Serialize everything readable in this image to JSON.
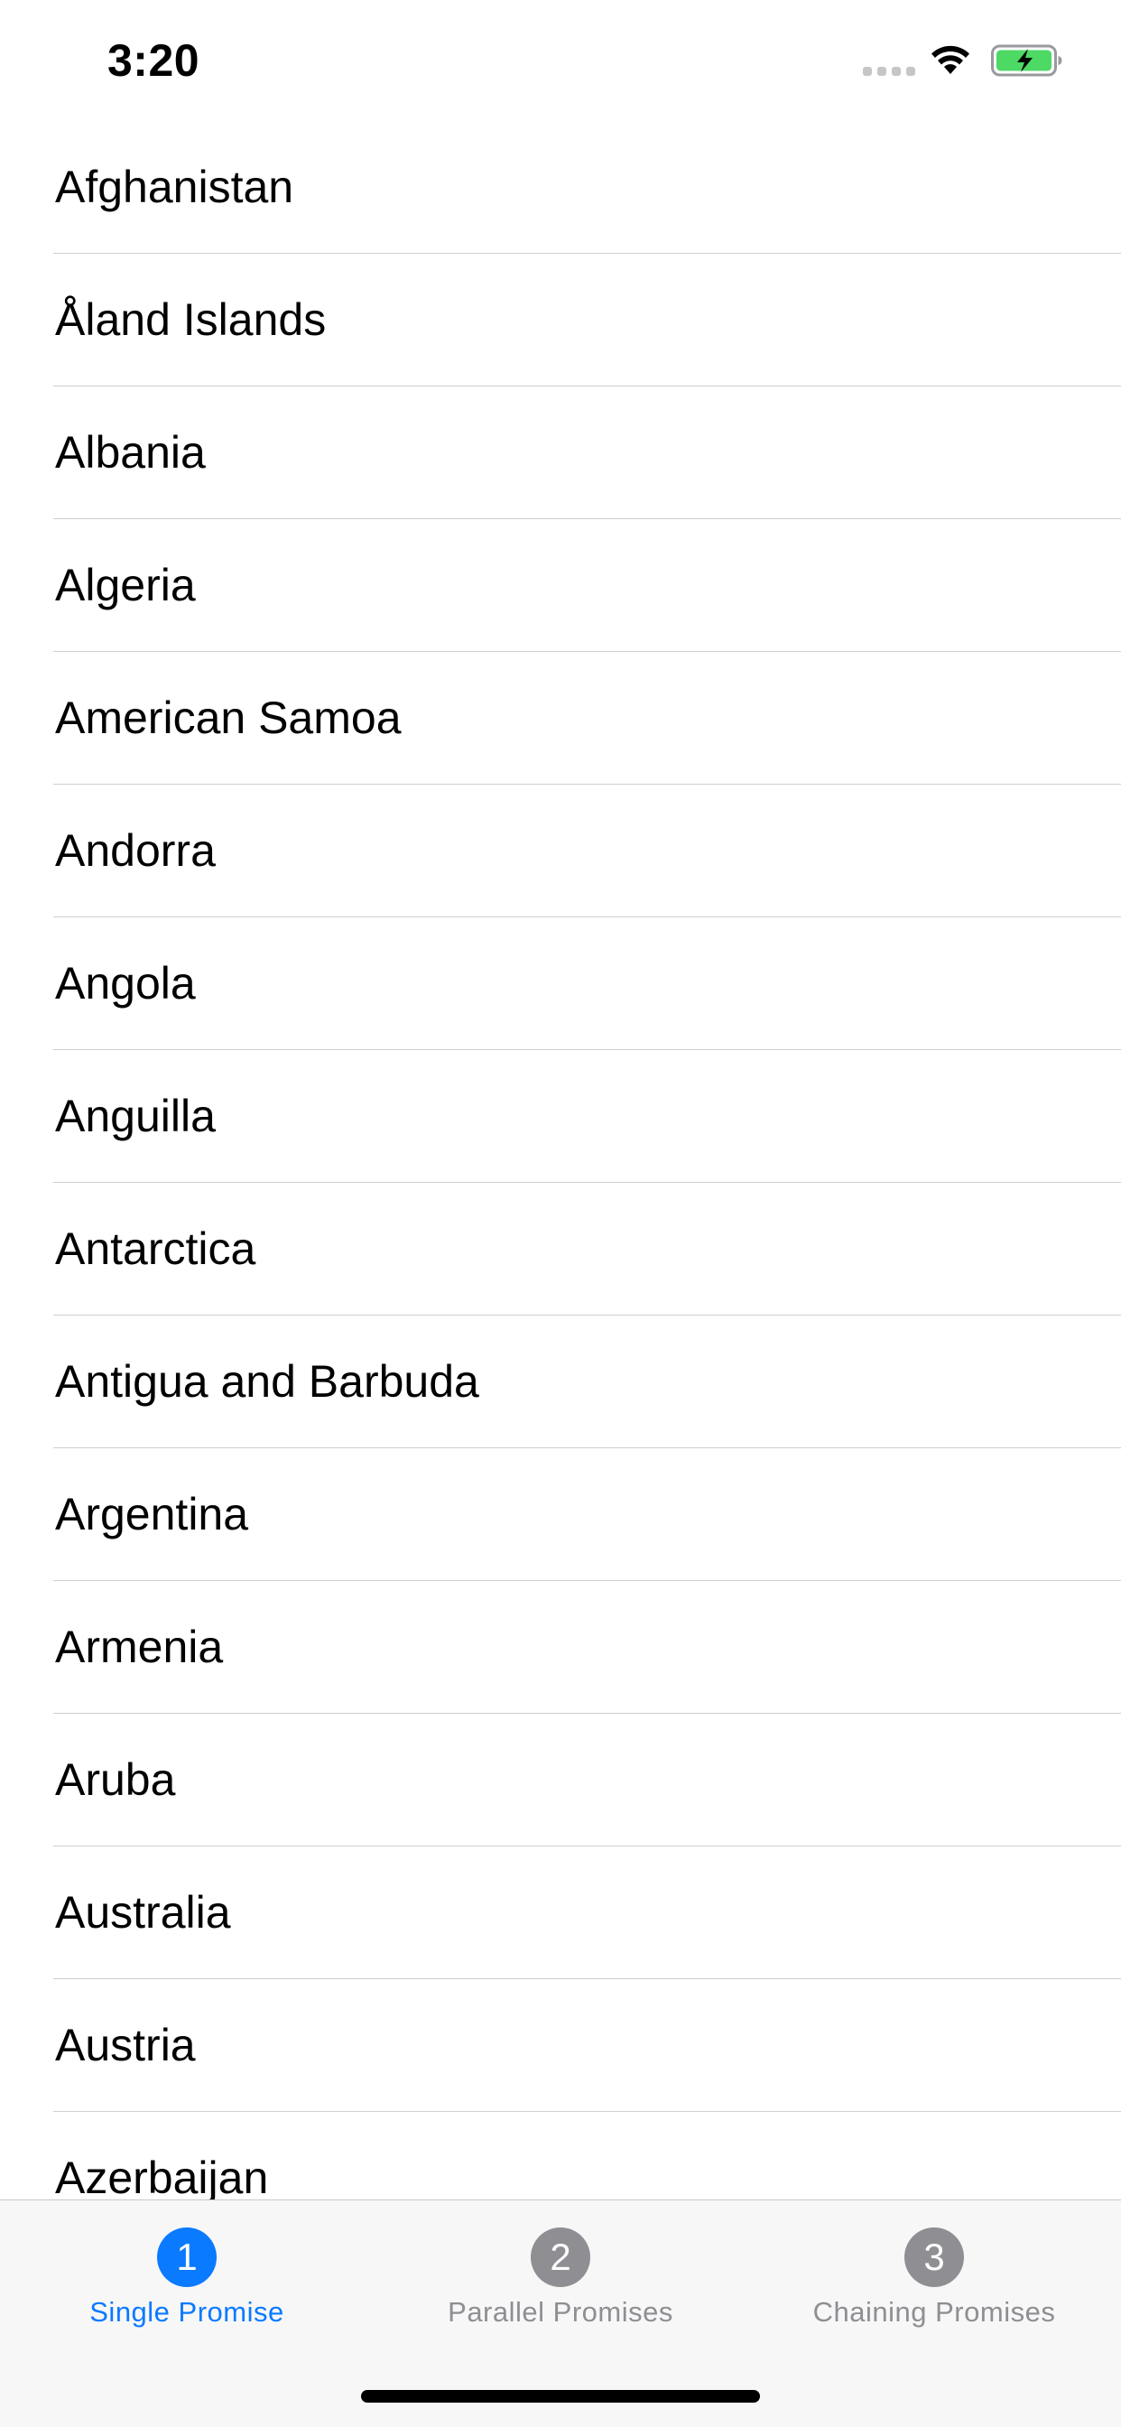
{
  "status_bar": {
    "time": "3:20",
    "signal_icon": "cellular-signal-icon",
    "wifi_icon": "wifi-icon",
    "battery_icon": "battery-charging-icon",
    "battery_color": "#4cd964"
  },
  "list": {
    "items": [
      "Afghanistan",
      "Åland Islands",
      "Albania",
      "Algeria",
      "American Samoa",
      "Andorra",
      "Angola",
      "Anguilla",
      "Antarctica",
      "Antigua and Barbuda",
      "Argentina",
      "Armenia",
      "Aruba",
      "Australia",
      "Austria",
      "Azerbaijan"
    ]
  },
  "tab_bar": {
    "active_color": "#0a7aff",
    "inactive_color": "#8e8e93",
    "tabs": [
      {
        "number": "1",
        "label": "Single Promise",
        "active": true
      },
      {
        "number": "2",
        "label": "Parallel Promises",
        "active": false
      },
      {
        "number": "3",
        "label": "Chaining Promises",
        "active": false
      }
    ]
  }
}
